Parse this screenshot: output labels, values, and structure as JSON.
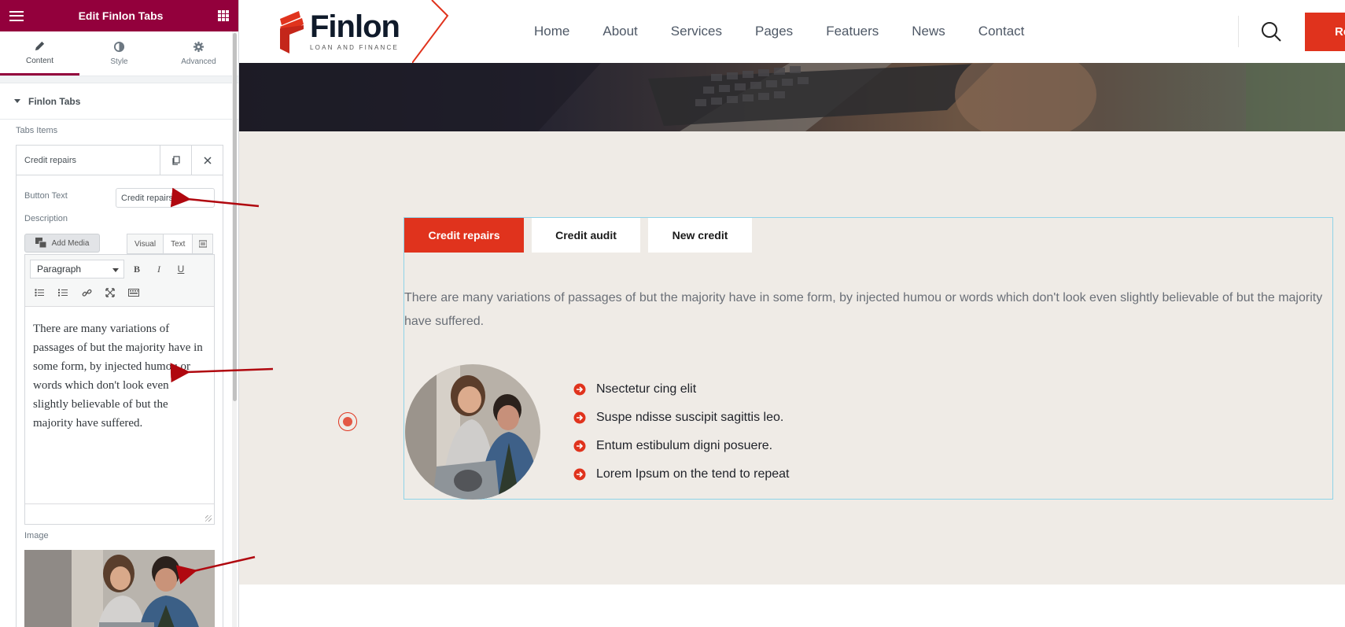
{
  "panel": {
    "title": "Edit Finlon Tabs",
    "tabs": [
      {
        "label": "Content",
        "icon": "pencil-icon"
      },
      {
        "label": "Style",
        "icon": "half-circle-icon"
      },
      {
        "label": "Advanced",
        "icon": "gear-icon"
      }
    ],
    "section_title": "Finlon Tabs",
    "tabs_items_label": "Tabs Items",
    "item_title": "Credit repairs",
    "button_text_label": "Button Text",
    "button_text_value": "Credit repairs",
    "description_label": "Description",
    "add_media_label": "Add Media",
    "editor_tabs": {
      "visual": "Visual",
      "text": "Text"
    },
    "format_select": "Paragraph",
    "toolbar_bold": "B",
    "toolbar_italic": "I",
    "toolbar_underline": "U",
    "editor_content": "There are many variations of passages of but the majority have in some form, by injected humou or words which don't look even slightly believable of but the majority have suffered.",
    "image_label": "Image",
    "accent_color": "#93003c"
  },
  "site": {
    "logo": {
      "name": "Finlon",
      "tagline": "LOAN AND FINANCE"
    },
    "nav": [
      "Home",
      "About",
      "Services",
      "Pages",
      "Featuers",
      "News",
      "Contact"
    ],
    "cta_label": "Re",
    "accent_color": "#e0331d",
    "tabs": [
      {
        "label": "Credit repairs",
        "active": true
      },
      {
        "label": "Credit audit",
        "active": false
      },
      {
        "label": "New credit",
        "active": false
      }
    ],
    "description": "There are many variations of passages of but the majority have in some form, by injected humou or words which don't look even slightly believable of but the majority have suffered.",
    "list": [
      "Nsectetur cing elit",
      "Suspe ndisse suscipit sagittis leo.",
      "Entum estibulum digni posuere.",
      "Lorem Ipsum on the tend to repeat"
    ]
  }
}
